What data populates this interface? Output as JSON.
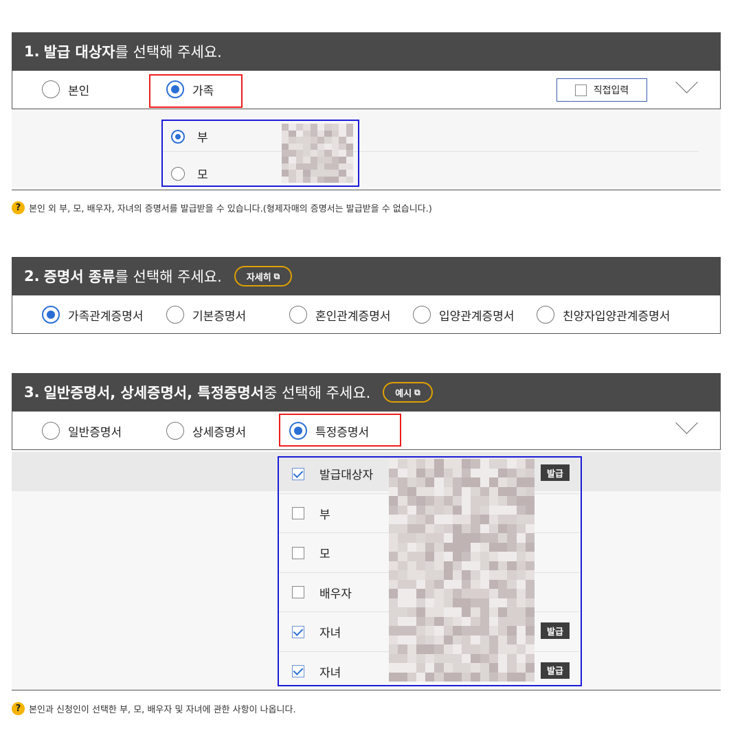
{
  "section1": {
    "num": "1.",
    "title_bold": "발급 대상자",
    "title_rest": "를 선택해 주세요.",
    "options": [
      "본인",
      "가족"
    ],
    "selected": "가족",
    "direct_input_label": "직접입력",
    "family_options": [
      "부",
      "모"
    ],
    "family_selected": "부",
    "help_text": "본인 외 부, 모, 배우자, 자녀의 증명서를 발급받을 수 있습니다.(형제자매의 증명서는 발급받을 수 없습니다.)"
  },
  "section2": {
    "num": "2.",
    "title_bold": "증명서 종류",
    "title_rest": "를 선택해 주세요.",
    "detail_button": "자세히",
    "options": [
      "가족관계증명서",
      "기본증명서",
      "혼인관계증명서",
      "입양관계증명서",
      "친양자입양관계증명서"
    ],
    "selected": "가족관계증명서"
  },
  "section3": {
    "num": "3.",
    "title_bold": "일반증명서, 상세증명서, 특정증명서",
    "title_rest": " 중 선택해 주세요.",
    "example_button": "예시",
    "options": [
      "일반증명서",
      "상세증명서",
      "특정증명서"
    ],
    "selected": "특정증명서",
    "persons": [
      {
        "label": "발급대상자",
        "checked": true,
        "tag": "발급"
      },
      {
        "label": "부",
        "checked": false,
        "tag": ""
      },
      {
        "label": "모",
        "checked": false,
        "tag": ""
      },
      {
        "label": "배우자",
        "checked": false,
        "tag": ""
      },
      {
        "label": "자녀",
        "checked": true,
        "tag": "발급"
      },
      {
        "label": "자녀",
        "checked": true,
        "tag": "발급"
      }
    ],
    "help_text": "본인과 신청인이 선택한 부, 모, 배우자 및 자녀에 관한 사항이 나옵니다."
  },
  "colors": {
    "header_bg": "#4a4a4a",
    "accent_blue": "#2b6fd6",
    "highlight_red": "#ee1c1c",
    "highlight_blue": "#1a1ad8",
    "pill_border": "#e0a000"
  },
  "icons": [
    "radio-icon",
    "checkbox-icon",
    "chevron-down-icon",
    "external-link-icon",
    "help-icon"
  ]
}
